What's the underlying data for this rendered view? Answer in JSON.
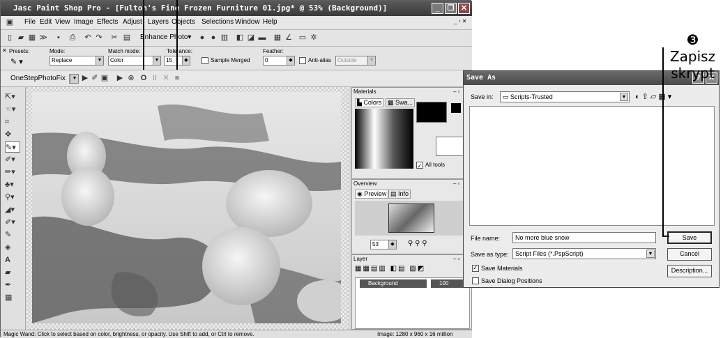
{
  "window": {
    "title": "Jasc Paint Shop Pro - [Fulton's Fine Frozen Furniture 01.jpg* @ 53% (Background)]",
    "status": "Magic Wand: Click to select based on color, brightness, or opacity. Use Shift to add, or Ctrl to remove.",
    "image_info": "Image:  1280 x 960 x 16 million"
  },
  "menu": [
    "File",
    "Edit",
    "View",
    "Image",
    "Effects",
    "Adjust",
    "Layers",
    "Objects",
    "Selections",
    "Window",
    "Help"
  ],
  "toolbar": {
    "enhance_photo": "Enhance Photo"
  },
  "options": {
    "presets_label": "Presets:",
    "mode_label": "Mode:",
    "mode_value": "Replace",
    "match_mode_label": "Match mode:",
    "match_mode_value": "Color",
    "tolerance_label": "Tolerance:",
    "tolerance_value": "15",
    "sample_merged": "Sample Merged",
    "feather_label": "Feather:",
    "feather_value": "0",
    "anti_alias": "Anti-alias",
    "outside": "Outside"
  },
  "script": {
    "name": "OneStepPhotoFix"
  },
  "materials": {
    "title": "Materials",
    "tab_colors": "Colors",
    "tab_swatches": "Swa...",
    "all_tools": "All tools"
  },
  "overview": {
    "title": "Overview",
    "tab_preview": "Preview",
    "tab_info": "Info",
    "zoom": "53"
  },
  "layers": {
    "title": "Layer",
    "background": "Background",
    "opacity": "100"
  },
  "save_dialog": {
    "title": "Save As",
    "save_in_label": "Save in:",
    "save_in_value": "Scripts-Trusted",
    "file_name_label": "File name:",
    "file_name_value": "No more blue snow",
    "save_type_label": "Save as type:",
    "save_type_value": "Script Files (*.PspScript)",
    "save_materials": "Save Materials",
    "save_dialog_positions": "Save Dialog Positions",
    "save_button": "Save",
    "cancel_button": "Cancel",
    "description_button": "Description..."
  },
  "annotation": {
    "number": "❸",
    "line1": "Zapisz",
    "line2": "skrypt"
  }
}
